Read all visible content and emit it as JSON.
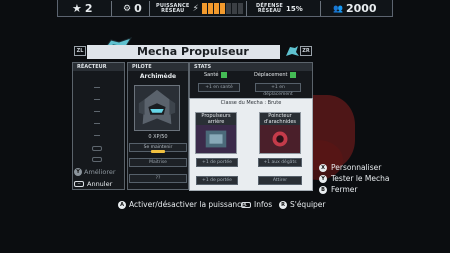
{
  "hud": {
    "stars": "2",
    "gears": "0",
    "power_label_1": "PUISSANCE",
    "power_label_2": "RÉSEAU",
    "power_level": 0.5,
    "defense_label_1": "DÉFENSE",
    "defense_label_2": "RÉSEAU",
    "defense_value": "15%",
    "population": "2000"
  },
  "header": {
    "title": "Mecha Propulseur",
    "left_key": "ZL",
    "right_key": "ZR"
  },
  "reactor": {
    "label": "RÉACTEUR",
    "upgrade_label": "Améliorer",
    "cancel_label": "Annuler"
  },
  "pilot": {
    "label": "PILOTE",
    "name": "Archimède",
    "xp": "0 XP/50",
    "buttons": [
      "Se maintenir",
      "Maitrise",
      "??"
    ]
  },
  "stats": {
    "label": "STATS",
    "health_label": "Santé",
    "move_label": "Déplacement",
    "boxes": [
      "+1 en santé",
      "+1 en déplacement"
    ],
    "class_label": "Classe du Mecha : Brute",
    "modules": [
      {
        "name": "Propulseurs arrière"
      },
      {
        "name": "Poincteur d'arachnides"
      }
    ],
    "module_buttons": [
      "+1 de portée",
      "+1 aux dégâts",
      "+1 de portée",
      "Attirer"
    ]
  },
  "right_menu": [
    {
      "key": "X",
      "label": "Personnaliser"
    },
    {
      "key": "Y",
      "label": "Tester le Mecha"
    },
    {
      "key": "B",
      "label": "Fermer"
    }
  ],
  "bottom_bar": [
    {
      "key": "A",
      "label": "Activer/désactiver la puissance"
    },
    {
      "key": "L",
      "label": "Infos"
    },
    {
      "key": "R",
      "label": "S'équiper"
    }
  ]
}
